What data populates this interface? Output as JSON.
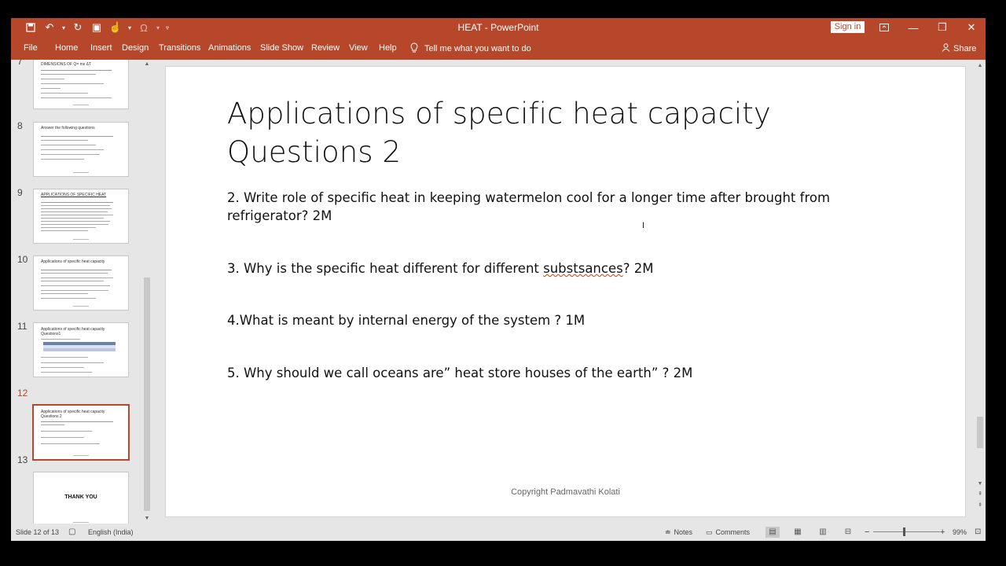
{
  "window": {
    "title": "HEAT  -  PowerPoint",
    "sign_in": "Sign in"
  },
  "ribbon": {
    "tabs": [
      "File",
      "Home",
      "Insert",
      "Design",
      "Transitions",
      "Animations",
      "Slide Show",
      "Review",
      "View",
      "Help"
    ],
    "tell_me": "Tell me what you want to do",
    "share": "Share"
  },
  "thumbnails": [
    {
      "number": "8",
      "title": "Answer the following questions"
    },
    {
      "number": "9",
      "title": "APPLICATIONS OF SPECIFIC HEAT"
    },
    {
      "number": "10",
      "title": "Applications of specific heat capacity"
    },
    {
      "number": "11",
      "title": "Applications of specific heat capacity Questions1"
    },
    {
      "number": "12",
      "title": "Applications of specific heat capacity Questions 2"
    },
    {
      "number": "13",
      "title": "THANK YOU"
    }
  ],
  "thumbnail_partial": {
    "title": "DIMENSIONS OF Q= ms ΔT"
  },
  "slide": {
    "title_line1": "Applications of specific heat capacity",
    "title_line2": "Questions 2",
    "q2_line1": "2. Write role of specific heat in keeping watermelon cool for a longer time after brought from",
    "q2_line2": "refrigerator?  2M",
    "q3_before": "3. Why is the specific heat different for different ",
    "q3_misspelled": "substsances",
    "q3_after": "?  2M",
    "q4": "4.What is meant by internal energy of the system ?  1M",
    "q5": "5. Why should we call oceans are” heat  store houses of the earth” ? 2M",
    "copyright": "Copyright Padmavathi Kolati"
  },
  "status": {
    "slide_info": "Slide 12 of 13",
    "language": "English (India)",
    "notes": "Notes",
    "comments": "Comments",
    "zoom": "99%"
  }
}
